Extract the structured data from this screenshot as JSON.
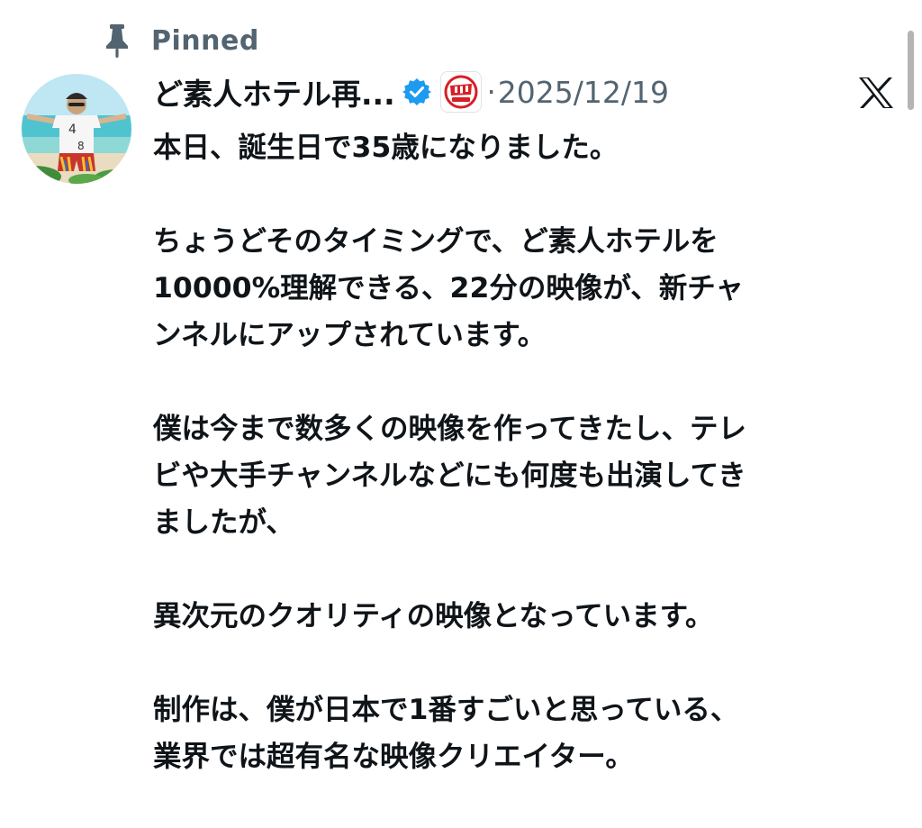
{
  "pinned": {
    "label": "Pinned",
    "icon": "pin-icon"
  },
  "author": {
    "display_name": "ど素人ホテル再...",
    "verified_icon": "verified-badge-icon",
    "affiliate_icon": "affiliate-channel-badge",
    "separator": "·",
    "date": "2025/12/19"
  },
  "platform": {
    "icon": "x-logo-icon"
  },
  "post": {
    "lines": [
      "本日、誕生日で35歳になりました。",
      "",
      "ちょうどそのタイミングで、ど素人ホテルを",
      "10000%理解できる、22分の映像が、新チャ",
      "ンネルにアップされています。",
      "",
      "僕は今まで数多くの映像を作ってきたし、テレ",
      "ビや大手チャンネルなどにも何度も出演してき",
      "ましたが、",
      "",
      "異次元のクオリティの映像となっています。",
      "",
      "制作は、僕が日本で1番すごいと思っている、",
      "業界では超有名な映像クリエイター。"
    ]
  },
  "colors": {
    "text_primary": "#0f1419",
    "text_secondary": "#536471",
    "verified_blue": "#1d9bf0",
    "background": "#ffffff"
  }
}
